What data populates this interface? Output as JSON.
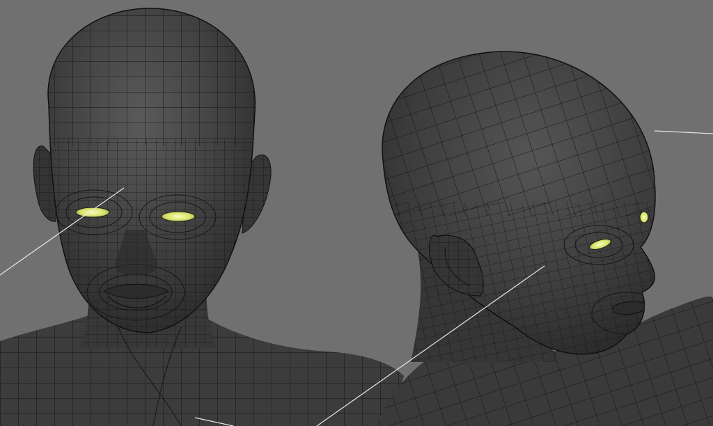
{
  "viewport": {
    "background_color": "#6f6f6f",
    "mesh_fill_color": "#3a3a3a",
    "wire_color": "#111111",
    "eye_color": "#e9f08a"
  },
  "scene": {
    "objects": [
      {
        "kind": "head-mesh",
        "view": "front",
        "eye_count": 2
      },
      {
        "kind": "head-mesh",
        "view": "three-quarter",
        "eye_count": 2
      }
    ],
    "guide_lines_count": 4
  }
}
